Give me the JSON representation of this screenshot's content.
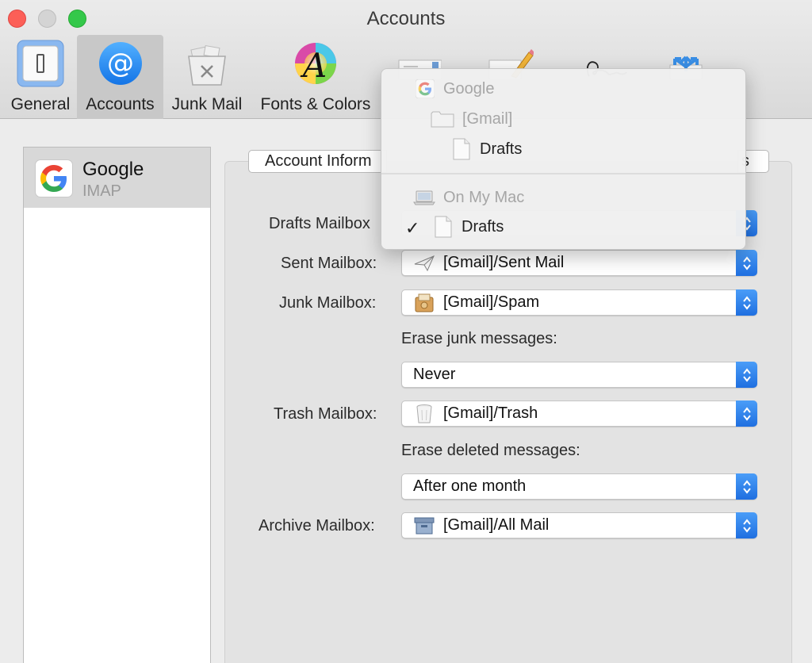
{
  "window": {
    "title": "Accounts"
  },
  "toolbar": {
    "items": [
      {
        "label": "General",
        "icon": "switch-icon"
      },
      {
        "label": "Accounts",
        "icon": "at-sign-icon",
        "selected": true
      },
      {
        "label": "Junk Mail",
        "icon": "trash-bin-icon"
      },
      {
        "label": "Fonts & Colors",
        "icon": "fonts-colors-icon"
      },
      {
        "label": "",
        "icon": "envelope-icon"
      },
      {
        "label": "",
        "icon": "pencil-icon"
      },
      {
        "label": "",
        "icon": "signature-icon"
      },
      {
        "label": "",
        "icon": "rules-icon"
      }
    ]
  },
  "accounts": [
    {
      "name": "Google",
      "type": "IMAP"
    }
  ],
  "tabs": {
    "left_label": "Account Inform",
    "right_label": "s"
  },
  "fields": {
    "drafts_label": "Drafts Mailbox",
    "sent_label": "Sent Mailbox:",
    "sent_value": "[Gmail]/Sent Mail",
    "junk_label": "Junk Mailbox:",
    "junk_value": "[Gmail]/Spam",
    "erase_junk_label": "Erase junk messages:",
    "erase_junk_value": "Never",
    "trash_label": "Trash Mailbox:",
    "trash_value": "[Gmail]/Trash",
    "erase_deleted_label": "Erase deleted messages:",
    "erase_deleted_value": "After one month",
    "archive_label": "Archive Mailbox:",
    "archive_value": "[Gmail]/All Mail"
  },
  "menu": {
    "google_header": "Google",
    "gmail_folder": "[Gmail]",
    "gmail_drafts": "Drafts",
    "mac_header": "On My Mac",
    "mac_drafts": "Drafts",
    "checkmark": "✓"
  },
  "colors": {
    "accent": "#1f6fe0",
    "close": "#fc5f57",
    "zoom": "#34c84a"
  }
}
